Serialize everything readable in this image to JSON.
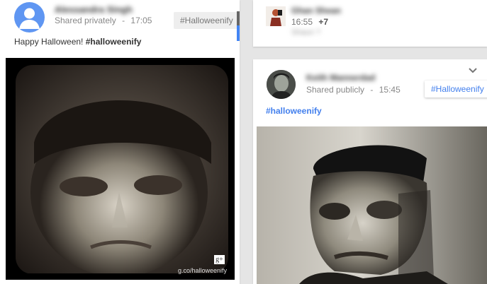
{
  "posts": [
    {
      "author": "Alessandra Singh",
      "visibility": "Shared privately",
      "time": "17:05",
      "hashtag_chip": "#Halloweenify",
      "caption_text": "Happy Halloween! ",
      "caption_hashtag": "#halloweenify",
      "watermark": "g.co/halloweenify",
      "watermark_badge": "g+"
    },
    {
      "author": "Ghan Shean",
      "time": "16:55",
      "plus_count": "+7",
      "sub": "Shaun ?"
    },
    {
      "author": "Keith Mannerdad",
      "visibility": "Shared publicly",
      "time": "15:45",
      "hashtag_chip": "#Halloweenify",
      "caption_hashtag": "#halloweenify"
    }
  ],
  "separator": "-",
  "colors": {
    "link_blue": "#427fed",
    "chip_bg": "#eeeeee",
    "page_bg": "#e5e5e5"
  },
  "icons": {
    "menu": "chevron-down-icon",
    "default_avatar": "person-icon"
  }
}
